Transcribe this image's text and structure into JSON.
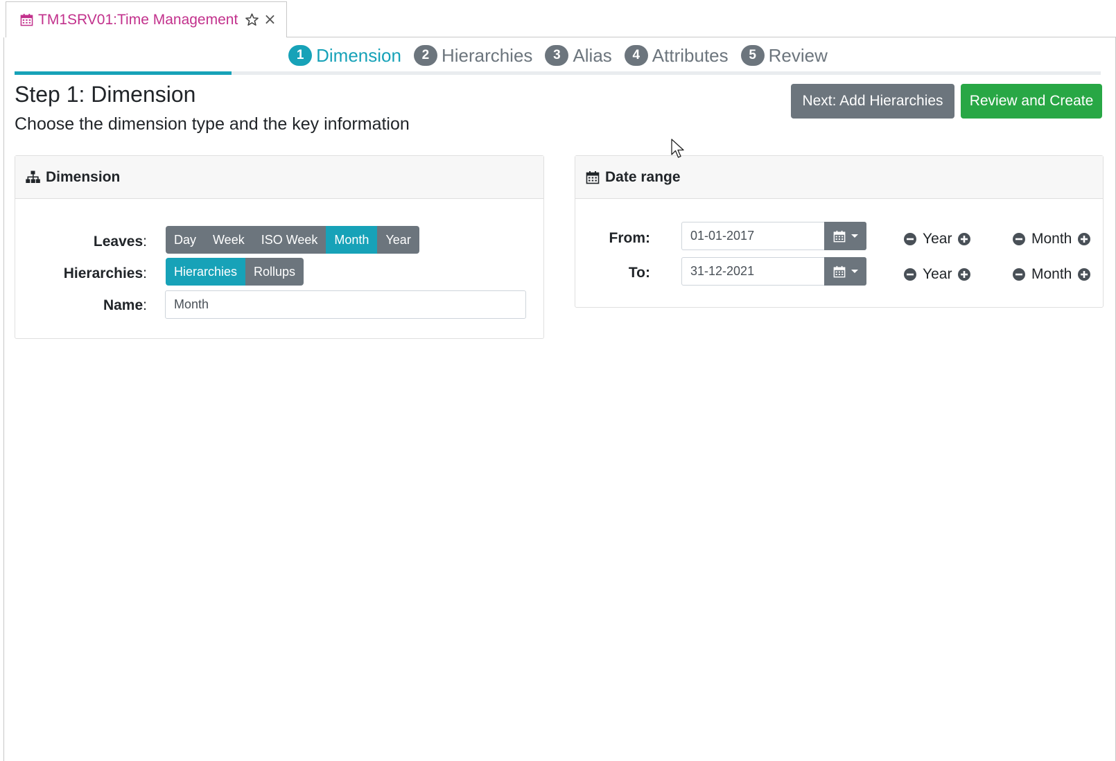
{
  "tab": {
    "title": "TM1SRV01:Time Management"
  },
  "steps": [
    {
      "num": "1",
      "label": "Dimension",
      "active": true
    },
    {
      "num": "2",
      "label": "Hierarchies"
    },
    {
      "num": "3",
      "label": "Alias"
    },
    {
      "num": "4",
      "label": "Attributes"
    },
    {
      "num": "5",
      "label": "Review"
    }
  ],
  "progress": {
    "fraction": 0.2
  },
  "header": {
    "title": "Step 1: Dimension",
    "subtitle": "Choose the dimension type and the key information",
    "next_label": "Next: Add Hierarchies",
    "review_label": "Review and Create"
  },
  "dimension_card": {
    "title": "Dimension",
    "leaves_label": "Leaves",
    "hierarchies_label": "Hierarchies",
    "name_label": "Name",
    "leaves_options": [
      "Day",
      "Week",
      "ISO Week",
      "Month",
      "Year"
    ],
    "leaves_selected": "Month",
    "hier_options": [
      "Hierarchies",
      "Rollups"
    ],
    "hier_selected": "Hierarchies",
    "name_value": "Month"
  },
  "date_card": {
    "title": "Date range",
    "from_label": "From:",
    "to_label": "To:",
    "from_value": "01-01-2017",
    "to_value": "31-12-2021",
    "year_label": "Year",
    "month_label": "Month"
  },
  "colors": {
    "accent": "#17a2b8",
    "secondary": "#6c757d",
    "success": "#28a745",
    "tab_title": "#c2318c"
  },
  "icons": [
    "calendar-icon",
    "star-icon",
    "close-icon",
    "sitemap-icon",
    "minus-circle-icon",
    "plus-circle-icon",
    "caret-down-icon",
    "mouse-cursor"
  ]
}
